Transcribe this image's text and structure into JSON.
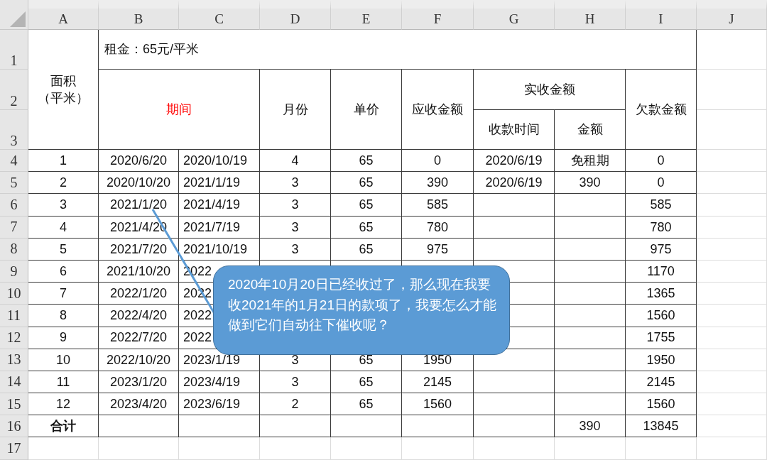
{
  "sheet": {
    "column_headers": [
      "A",
      "B",
      "C",
      "D",
      "E",
      "F",
      "G",
      "H",
      "I",
      "J"
    ],
    "row_headers": [
      "1",
      "2",
      "3",
      "4",
      "5",
      "6",
      "7",
      "8",
      "9",
      "10",
      "11",
      "12",
      "13",
      "14",
      "15",
      "16",
      "17"
    ],
    "header": {
      "area": [
        "面积",
        "（平米）"
      ],
      "rent": "租金：65元/平米",
      "period": "期间",
      "months": "月份",
      "unit_price": "单价",
      "receivable": "应收金额",
      "received": {
        "title": "实收金额",
        "date": "收款时间",
        "amount": "金额"
      },
      "arrears": "欠款金额"
    },
    "rows": [
      {
        "kind": "data",
        "cells": [
          "1",
          "2020/6/20",
          "2020/10/19",
          "4",
          "65",
          "0",
          "2020/6/19",
          "免租期",
          "0"
        ]
      },
      {
        "kind": "data",
        "cells": [
          "2",
          "2020/10/20",
          "2021/1/19",
          "3",
          "65",
          "390",
          "2020/6/19",
          "390",
          "0"
        ]
      },
      {
        "kind": "data",
        "cells": [
          "3",
          "2021/1/20",
          "2021/4/19",
          "3",
          "65",
          "585",
          null,
          null,
          "585"
        ]
      },
      {
        "kind": "data",
        "cells": [
          "4",
          "2021/4/20",
          "2021/7/19",
          "3",
          "65",
          "780",
          null,
          null,
          "780"
        ]
      },
      {
        "kind": "data",
        "cells": [
          "5",
          "2021/7/20",
          "2021/10/19",
          "3",
          "65",
          "975",
          null,
          null,
          "975"
        ]
      },
      {
        "kind": "data",
        "cells": [
          "6",
          "2021/10/20",
          "2022",
          null,
          null,
          null,
          null,
          null,
          "1170"
        ]
      },
      {
        "kind": "data",
        "cells": [
          "7",
          "2022/1/20",
          "2022",
          null,
          null,
          null,
          null,
          null,
          "1365"
        ]
      },
      {
        "kind": "data",
        "cells": [
          "8",
          "2022/4/20",
          "2022",
          null,
          null,
          null,
          null,
          null,
          "1560"
        ]
      },
      {
        "kind": "data",
        "cells": [
          "9",
          "2022/7/20",
          "2022",
          null,
          null,
          null,
          null,
          null,
          "1755"
        ]
      },
      {
        "kind": "data",
        "cells": [
          "10",
          "2022/10/20",
          "2023/1/19",
          "3",
          "65",
          "1950",
          null,
          null,
          "1950"
        ]
      },
      {
        "kind": "data",
        "cells": [
          "11",
          "2023/1/20",
          "2023/4/19",
          "3",
          "65",
          "2145",
          null,
          null,
          "2145"
        ]
      },
      {
        "kind": "data",
        "cells": [
          "12",
          "2023/4/20",
          "2023/6/19",
          "2",
          "65",
          "1560",
          null,
          null,
          "1560"
        ]
      },
      {
        "kind": "total",
        "cells": [
          "合计",
          null,
          null,
          null,
          null,
          null,
          null,
          "390",
          "13845"
        ]
      }
    ]
  },
  "callout": {
    "text": "2020年10月20日已经收过了，那么现在我要收2021年的1月21日的款项了，我要怎么才能做到它们自动往下催收呢？"
  }
}
